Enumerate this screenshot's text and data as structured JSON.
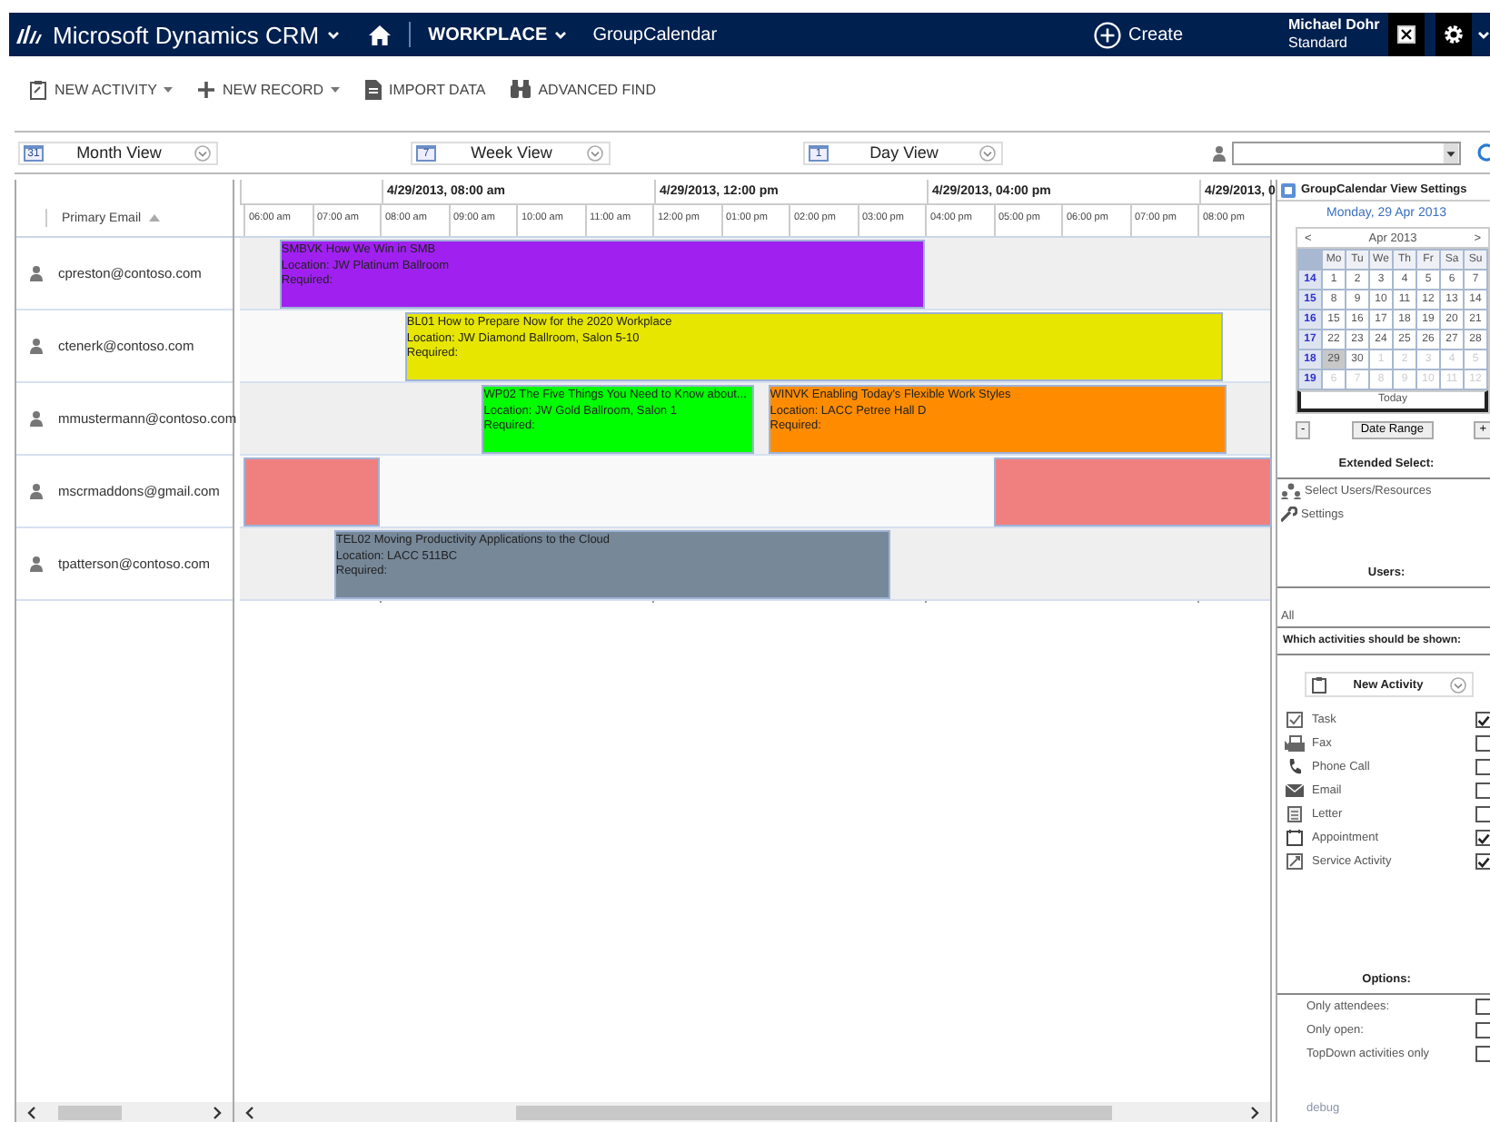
{
  "nav": {
    "app_title": "Microsoft Dynamics CRM",
    "area": "WORKPLACE",
    "page": "GroupCalendar",
    "create": "Create",
    "user_name": "Michael Dohr",
    "user_role": "Standard"
  },
  "commands": [
    {
      "label": "NEW ACTIVITY",
      "kind": "activity",
      "dropdown": true
    },
    {
      "label": "NEW RECORD",
      "kind": "record",
      "dropdown": true
    },
    {
      "label": "IMPORT DATA",
      "kind": "import",
      "dropdown": false
    },
    {
      "label": "ADVANCED FIND",
      "kind": "find",
      "dropdown": false
    }
  ],
  "views": [
    {
      "label": "Month View",
      "badge": "31"
    },
    {
      "label": "Week View",
      "badge": "7"
    },
    {
      "label": "Day View",
      "badge": "1"
    }
  ],
  "schedule": {
    "column_heading": "Primary Email",
    "date_headers": [
      "4/29/2013, 08:00 am",
      "4/29/2013, 12:00 pm",
      "4/29/2013, 04:00 pm",
      "4/29/2013, 0"
    ],
    "hours": [
      "06:00 am",
      "07:00 am",
      "08:00 am",
      "09:00 am",
      "10:00 am",
      "11:00 am",
      "12:00 pm",
      "01:00 pm",
      "02:00 pm",
      "03:00 pm",
      "04:00 pm",
      "05:00 pm",
      "06:00 pm",
      "07:00 pm",
      "08:00 pm"
    ],
    "rows": [
      {
        "email": "cpreston@contoso.com",
        "events": [
          {
            "title": "SMBVK How We Win in SMB",
            "location": "Location: JW Platinum Ballroom",
            "required": "Required:",
            "color": "#a020f0"
          }
        ]
      },
      {
        "email": "ctenerk@contoso.com",
        "events": [
          {
            "title": "BL01 How to Prepare Now for the 2020 Workplace",
            "location": "Location: JW Diamond Ballroom, Salon 5-10",
            "required": "Required:",
            "color": "#e6e600"
          }
        ]
      },
      {
        "email": "mmustermann@contoso.com",
        "events": [
          {
            "title": "WP02 The Five Things You Need to Know about...",
            "location": "Location: JW Gold Ballroom, Salon 1",
            "required": "Required:",
            "color": "#00ff00"
          },
          {
            "title": "WINVK Enabling Today's Flexible Work Styles",
            "location": "Location: LACC Petree Hall D",
            "required": "Required:",
            "color": "#ff8c00"
          }
        ]
      },
      {
        "email": "mscrmaddons@gmail.com",
        "events": [
          {
            "color": "#f08080"
          },
          {
            "color": "#f08080"
          }
        ]
      },
      {
        "email": "tpatterson@contoso.com",
        "events": [
          {
            "title": "TEL02 Moving Productivity Applications to the Cloud",
            "location": "Location: LACC 511BC",
            "required": "Required:",
            "color": "#778899"
          }
        ]
      }
    ]
  },
  "settings": {
    "title": "GroupCalendar View Settings",
    "date": "Monday, 29 Apr 2013",
    "calendar": {
      "prev": "<",
      "month": "Apr 2013",
      "next": ">",
      "weekdays": [
        "Mo",
        "Tu",
        "We",
        "Th",
        "Fr",
        "Sa",
        "Su"
      ],
      "weeks": [
        {
          "number": "14",
          "days": [
            {
              "day": "1",
              "other_month": false,
              "selected": false
            },
            {
              "day": "2",
              "other_month": false,
              "selected": false
            },
            {
              "day": "3",
              "other_month": false,
              "selected": false
            },
            {
              "day": "4",
              "other_month": false,
              "selected": false
            },
            {
              "day": "5",
              "other_month": false,
              "selected": false
            },
            {
              "day": "6",
              "other_month": false,
              "selected": false
            },
            {
              "day": "7",
              "other_month": false,
              "selected": false
            }
          ]
        },
        {
          "number": "15",
          "days": [
            {
              "day": "8",
              "other_month": false,
              "selected": false
            },
            {
              "day": "9",
              "other_month": false,
              "selected": false
            },
            {
              "day": "10",
              "other_month": false,
              "selected": false
            },
            {
              "day": "11",
              "other_month": false,
              "selected": false
            },
            {
              "day": "12",
              "other_month": false,
              "selected": false
            },
            {
              "day": "13",
              "other_month": false,
              "selected": false
            },
            {
              "day": "14",
              "other_month": false,
              "selected": false
            }
          ]
        },
        {
          "number": "16",
          "days": [
            {
              "day": "15",
              "other_month": false,
              "selected": false
            },
            {
              "day": "16",
              "other_month": false,
              "selected": false
            },
            {
              "day": "17",
              "other_month": false,
              "selected": false
            },
            {
              "day": "18",
              "other_month": false,
              "selected": false
            },
            {
              "day": "19",
              "other_month": false,
              "selected": false
            },
            {
              "day": "20",
              "other_month": false,
              "selected": false
            },
            {
              "day": "21",
              "other_month": false,
              "selected": false
            }
          ]
        },
        {
          "number": "17",
          "days": [
            {
              "day": "22",
              "other_month": false,
              "selected": false
            },
            {
              "day": "23",
              "other_month": false,
              "selected": false
            },
            {
              "day": "24",
              "other_month": false,
              "selected": false
            },
            {
              "day": "25",
              "other_month": false,
              "selected": false
            },
            {
              "day": "26",
              "other_month": false,
              "selected": false
            },
            {
              "day": "27",
              "other_month": false,
              "selected": false
            },
            {
              "day": "28",
              "other_month": false,
              "selected": false
            }
          ]
        },
        {
          "number": "18",
          "days": [
            {
              "day": "29",
              "other_month": false,
              "selected": true
            },
            {
              "day": "30",
              "other_month": false,
              "selected": false
            },
            {
              "day": "1",
              "other_month": true,
              "selected": false
            },
            {
              "day": "2",
              "other_month": true,
              "selected": false
            },
            {
              "day": "3",
              "other_month": true,
              "selected": false
            },
            {
              "day": "4",
              "other_month": true,
              "selected": false
            },
            {
              "day": "5",
              "other_month": true,
              "selected": false
            }
          ]
        },
        {
          "number": "19",
          "days": [
            {
              "day": "6",
              "other_month": true,
              "selected": false
            },
            {
              "day": "7",
              "other_month": true,
              "selected": false
            },
            {
              "day": "8",
              "other_month": true,
              "selected": false
            },
            {
              "day": "9",
              "other_month": true,
              "selected": false
            },
            {
              "day": "10",
              "other_month": true,
              "selected": false
            },
            {
              "day": "11",
              "other_month": true,
              "selected": false
            },
            {
              "day": "12",
              "other_month": true,
              "selected": false
            }
          ]
        }
      ],
      "today": "Today"
    },
    "range_minus": "-",
    "date_range": "Date Range",
    "range_plus": "+",
    "extended_heading": "Extended Select:",
    "links": [
      {
        "label": "Select Users/Resources",
        "kind": "users"
      },
      {
        "label": "Settings",
        "kind": "settings"
      }
    ],
    "users_heading": "Users:",
    "users": "All",
    "activities_heading": "Which activities should be shown:",
    "activity_dropdown": "New Activity",
    "activities": [
      {
        "label": "Task",
        "kind": "task",
        "checked": true
      },
      {
        "label": "Fax",
        "kind": "fax",
        "checked": false
      },
      {
        "label": "Phone Call",
        "kind": "phone",
        "checked": false
      },
      {
        "label": "Email",
        "kind": "email",
        "checked": false
      },
      {
        "label": "Letter",
        "kind": "letter",
        "checked": false
      },
      {
        "label": "Appointment",
        "kind": "appointment",
        "checked": true
      },
      {
        "label": "Service Activity",
        "kind": "service",
        "checked": true
      }
    ],
    "options_heading": "Options:",
    "options": [
      {
        "label": "Only attendees:",
        "checked": false
      },
      {
        "label": "Only open:",
        "checked": false
      },
      {
        "label": "TopDown activities only",
        "checked": false
      }
    ],
    "footer": "debug"
  }
}
